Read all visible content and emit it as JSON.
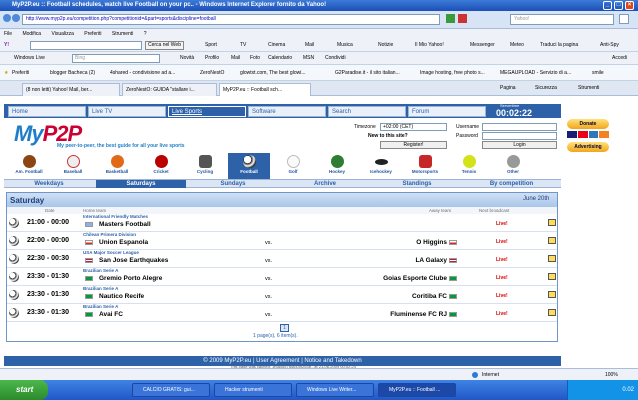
{
  "window": {
    "title": "MyP2P.eu :: Football schedules, watch live Football on your pc..  - Windows Internet Explorer fornito da Yahoo!",
    "url": "http://www.myp2p.eu/competition.php?competitionid=&part=sports&discipline=football",
    "search_placeholder": "Yahoo!"
  },
  "menu": [
    "File",
    "Modifica",
    "Visualizza",
    "Preferiti",
    "Strumenti",
    "?"
  ],
  "yahoo_toolbar": {
    "search_button": "Cerca nel Web",
    "items": [
      "Sport",
      "TV",
      "Cinema",
      "Mail",
      "Musica",
      "Notizie",
      "Il Mio Yahoo!",
      "Messenger",
      "Meteo",
      "Traduci la pagina",
      "Anti-Spy"
    ]
  },
  "live_toolbar": {
    "label": "Windows Live",
    "search_placeholder": "Bing",
    "items": [
      "Novità",
      "Profilo",
      "Mail",
      "Foto",
      "Calendario",
      "MSN",
      "Condividi"
    ],
    "accedi": "Accedi"
  },
  "favorites": {
    "label": "Preferiti",
    "items": [
      "blogger Bacheca (2)",
      "4shared - condivisione ad a...",
      "ZeroNestO",
      "glowtxt.com, The best glowi...",
      "G2Paradise.it - il sito italian...",
      "Image hosting, free photo s...",
      "MEGAUPLOAD - Servizio di a...",
      "smile"
    ]
  },
  "tabs": {
    "items": [
      "(8 non letti) Yahoo! Mail, ber...",
      "ZeroNestO: GUIDA \"stallare i...",
      "MyP2P.eu :: Football sch..."
    ],
    "pagina": "Pagina",
    "sicurezza": "Sicurezza",
    "strumenti": "Strumenti"
  },
  "site": {
    "nav": [
      "Home",
      "Live TV",
      "Live Sports",
      "Software",
      "Search",
      "Forum"
    ],
    "servertime_label": "Servertime",
    "servertime": "00:02:22",
    "logo_main": "My",
    "logo_two": "P2P",
    "tagline": "My peer-to-peer, the best guide for all your live sports",
    "timezone_label": "Timezone",
    "timezone_value": "+02:00 (CET)",
    "username_label": "Username",
    "password_label": "Password",
    "new_to_site": "New to this site?",
    "register": "Register!",
    "login": "Login",
    "sports": [
      "Am. Football",
      "Baseball",
      "Basketball",
      "Cricket",
      "Cycling",
      "Football",
      "Golf",
      "Hockey",
      "Icehockey",
      "Motorsports",
      "Tennis",
      "Other"
    ],
    "day_nav": [
      "Weekdays",
      "Saturdays",
      "Sundays",
      "Archive",
      "Standings",
      "By competition"
    ],
    "day_name": "Saturday",
    "day_date": "June 20th",
    "columns": {
      "date": "Date",
      "home": "Home team",
      "away": "Away team",
      "broadcast": "Next broadcast"
    },
    "matches": [
      {
        "time": "21:00 - 00:00",
        "league": "International Friendly Matches",
        "home": "Masters Football",
        "away": "",
        "vs": "",
        "live": "Live!"
      },
      {
        "time": "22:00 - 00:00",
        "league": "Chilean Primera Division",
        "home": "Union Espanola",
        "away": "O Higgins",
        "vs": "vs.",
        "live": "Live!"
      },
      {
        "time": "22:30 - 00:30",
        "league": "USA Major Soccer League",
        "home": "San Jose Earthquakes",
        "away": "LA Galaxy",
        "vs": "vs.",
        "live": "Live!"
      },
      {
        "time": "23:30 - 01:30",
        "league": "Brazilian Serie A",
        "home": "Gremio Porto Alegre",
        "away": "Goias Esporte Clube",
        "vs": "vs.",
        "live": "Live!"
      },
      {
        "time": "23:30 - 01:30",
        "league": "Brazilian Serie A",
        "home": "Nautico Recife",
        "away": "Coritiba FC",
        "vs": "vs.",
        "live": "Live!"
      },
      {
        "time": "23:30 - 01:30",
        "league": "Brazilian Serie A",
        "home": "Avai FC",
        "away": "Fluminense FC RJ",
        "vs": "vs.",
        "live": "Live!"
      }
    ],
    "pager": "1",
    "pager_info": "1 page(s), 6 item(s).",
    "footer": "© 2009 MyP2P.eu | User Agreement | Notice and Takedown",
    "footer_small": "This page was cached: 1f5a4557d464492d3b...at 21-06-2009 00:02:24",
    "donate": "Donate",
    "advertising": "Advertising"
  },
  "status": {
    "zone": "Internet",
    "zoom": "100%"
  },
  "taskbar": {
    "start": "start",
    "tasks": [
      "CALCIO GRATIS: gui...",
      "Hacker strumenti",
      "Windows Live Writer...",
      "MyP2P.eu :: Football ..."
    ],
    "clock": "0.02"
  },
  "colors": {
    "accent": "#2d62a9",
    "logo": "#1f7ec8",
    "live": "#d40000"
  }
}
